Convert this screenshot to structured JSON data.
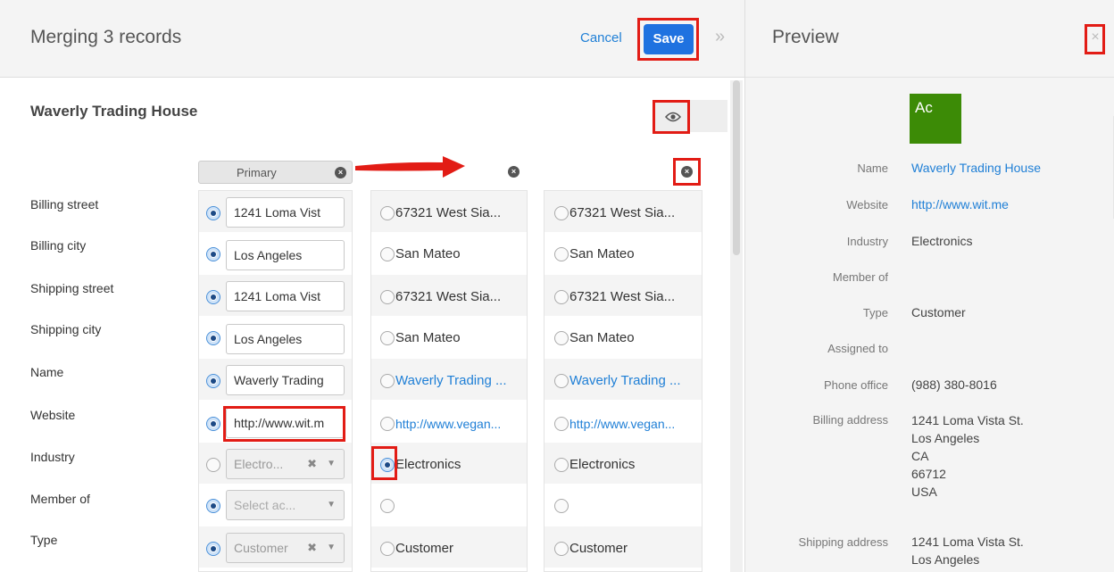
{
  "header": {
    "title": "Merging 3 records",
    "cancel_label": "Cancel",
    "save_label": "Save",
    "expand_glyph": "»"
  },
  "record_name": "Waverly Trading House",
  "primary_label": "Primary",
  "rows": [
    {
      "label": "Billing street"
    },
    {
      "label": "Billing city"
    },
    {
      "label": "Shipping street"
    },
    {
      "label": "Shipping city"
    },
    {
      "label": "Name"
    },
    {
      "label": "Website"
    },
    {
      "label": "Industry"
    },
    {
      "label": "Member of"
    },
    {
      "label": "Type"
    }
  ],
  "column1": {
    "billing_street": "1241 Loma Vist",
    "billing_city": "Los Angeles",
    "shipping_street": "1241 Loma Vist",
    "shipping_city": "Los Angeles",
    "name": "Waverly Trading",
    "website": "http://www.wit.m",
    "industry": "Electro...",
    "member_of_placeholder": "Select ac...",
    "type": "Customer"
  },
  "column2": {
    "billing_street": "67321 West Sia...",
    "billing_city": "San Mateo",
    "shipping_street": "67321 West Sia...",
    "shipping_city": "San Mateo",
    "name": "Waverly Trading ...",
    "website": "http://www.vegan...",
    "industry": "Electronics",
    "member_of": "",
    "type": "Customer"
  },
  "column3": {
    "billing_street": "67321 West Sia...",
    "billing_city": "San Mateo",
    "shipping_street": "67321 West Sia...",
    "shipping_city": "San Mateo",
    "name": "Waverly Trading ...",
    "website": "http://www.vegan...",
    "industry": "Electronics",
    "member_of": "",
    "type": "Customer"
  },
  "preview": {
    "title": "Preview",
    "close_glyph": "×",
    "avatar_initials": "Ac",
    "fields": {
      "name_label": "Name",
      "name_value": "Waverly Trading House",
      "website_label": "Website",
      "website_value": "http://www.wit.me",
      "industry_label": "Industry",
      "industry_value": "Electronics",
      "member_of_label": "Member of",
      "type_label": "Type",
      "type_value": "Customer",
      "assigned_to_label": "Assigned to",
      "phone_office_label": "Phone office",
      "phone_office_value": "(988) 380-8016",
      "billing_address_label": "Billing address",
      "billing_address_lines": [
        "1241 Loma Vista St.",
        "Los Angeles",
        "CA",
        "66712",
        "USA"
      ],
      "shipping_address_label": "Shipping address",
      "shipping_address_lines": [
        "1241 Loma Vista St.",
        "Los Angeles"
      ]
    }
  },
  "colors": {
    "accent": "#1f72e0",
    "link": "#1f7fd6",
    "callout": "#e21c15",
    "avatar": "#3c8b06"
  }
}
